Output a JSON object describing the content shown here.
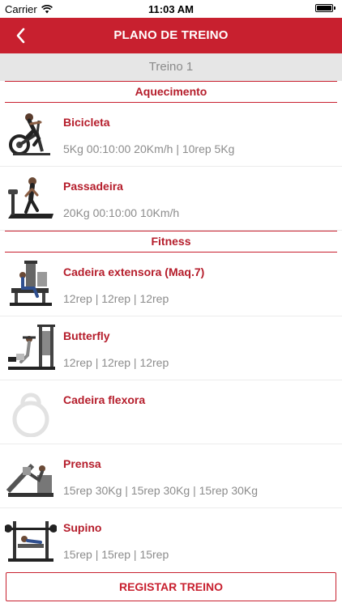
{
  "status_bar": {
    "carrier": "Carrier",
    "time": "11:03 AM"
  },
  "nav": {
    "title": "PLANO DE TREINO"
  },
  "sub_header": {
    "label": "Treino 1"
  },
  "sections": [
    {
      "title": "Aquecimento",
      "items": [
        {
          "name": "Bicicleta",
          "detail": "5Kg 00:10:00 20Km/h  | 10rep 5Kg",
          "image": "exercise-bike-icon"
        },
        {
          "name": "Passadeira",
          "detail": "20Kg 00:10:00 10Km/h",
          "image": "treadmill-icon"
        }
      ]
    },
    {
      "title": "Fitness",
      "items": [
        {
          "name": "Cadeira extensora (Maq.7)",
          "detail": "12rep  | 12rep  | 12rep",
          "image": "leg-extension-machine-icon"
        },
        {
          "name": "Butterfly",
          "detail": "12rep  | 12rep  | 12rep",
          "image": "butterfly-machine-icon"
        },
        {
          "name": "Cadeira flexora",
          "detail": "",
          "image": "kettlebell-icon"
        },
        {
          "name": "Prensa",
          "detail": "15rep 30Kg  | 15rep 30Kg  | 15rep 30Kg",
          "image": "leg-press-icon"
        },
        {
          "name": "Supino",
          "detail": "15rep  | 15rep  | 15rep",
          "image": "bench-press-icon"
        }
      ]
    }
  ],
  "footer": {
    "register_label": "REGISTAR TREINO"
  },
  "colors": {
    "accent": "#c8202f",
    "title_text": "#b51d2b",
    "detail_text": "#8c8c8c",
    "sub_header_bg": "#e6e6e6"
  }
}
